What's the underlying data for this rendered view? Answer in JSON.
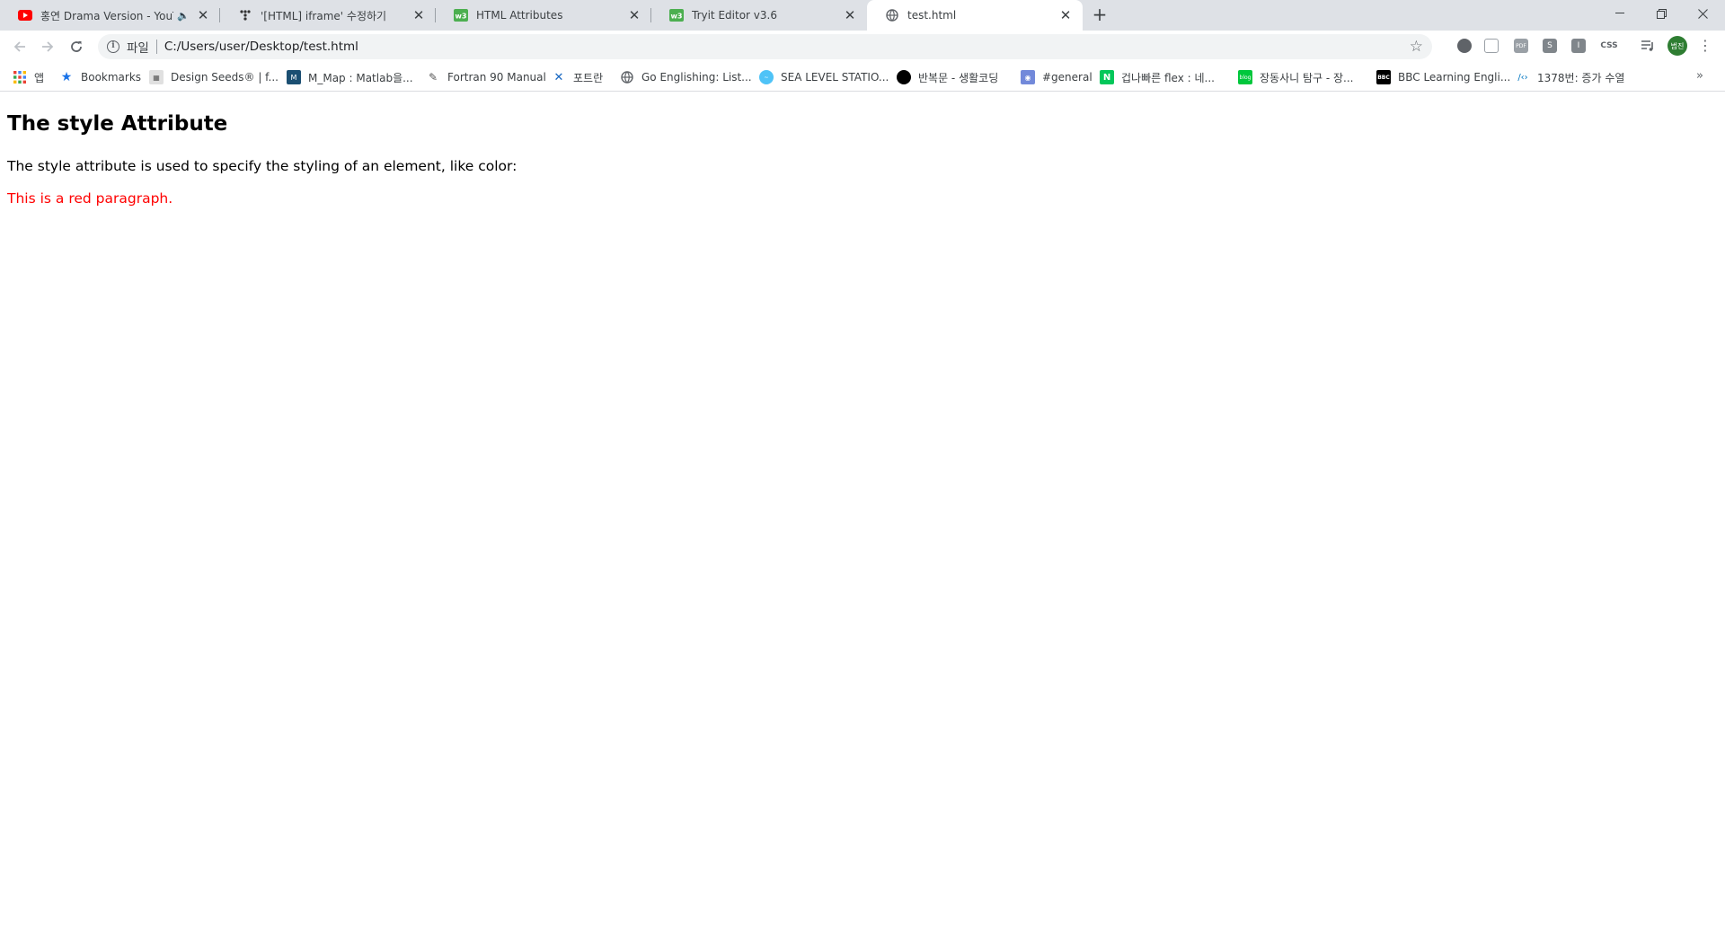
{
  "tabs": [
    {
      "title": "홍연 Drama Version - YouTube",
      "favicon": "youtube-icon",
      "muted": true
    },
    {
      "title": "'[HTML] iframe' 수정하기",
      "favicon": "tistory-icon"
    },
    {
      "title": "HTML Attributes",
      "favicon": "w3schools-icon"
    },
    {
      "title": "Tryit Editor v3.6",
      "favicon": "w3schools-icon"
    },
    {
      "title": "test.html",
      "favicon": "globe-icon",
      "active": true
    }
  ],
  "address_bar": {
    "scheme_label": "파일",
    "url": "C:/Users/user/Desktop/test.html"
  },
  "extensions": [
    {
      "label": "",
      "color": "#5f6368"
    },
    {
      "label": "",
      "color": "#9aa0a6"
    },
    {
      "label": "PDF",
      "color": "#9aa0a6"
    },
    {
      "label": "S",
      "color": "#80868b"
    },
    {
      "label": "I",
      "color": "#80868b"
    },
    {
      "label": "CSS",
      "color": "#ffffff"
    }
  ],
  "profile_initials": "범진",
  "bookmarks": [
    {
      "label": "앱",
      "icon": "apps-grid-icon",
      "color": "#ea4335"
    },
    {
      "label": "Bookmarks",
      "icon": "star-icon",
      "color": "#1a73e8"
    },
    {
      "label": "Design Seeds® | f...",
      "icon": "design-seeds-icon",
      "color": "#777777"
    },
    {
      "label": "M_Map : Matlab을...",
      "icon": "mmap-icon",
      "color": "#1b4f72"
    },
    {
      "label": "Fortran 90 Manual",
      "icon": "pencil-icon",
      "color": "#555555"
    },
    {
      "label": "포트란",
      "icon": "fortran-icon",
      "color": "#1565c0"
    },
    {
      "label": "Go Englishing: List...",
      "icon": "globe-icon",
      "color": "#5f6368"
    },
    {
      "label": "SEA LEVEL STATIO...",
      "icon": "sea-level-icon",
      "color": "#4fc3f7"
    },
    {
      "label": "반복문 - 생활코딩",
      "icon": "circle-icon",
      "color": "#000000"
    },
    {
      "label": "#general",
      "icon": "discord-icon",
      "color": "#7289da"
    },
    {
      "label": "겁나빠른 flex : 네...",
      "icon": "naver-icon",
      "color": "#03c75a"
    },
    {
      "label": "장동사니 탐구 - 장...",
      "icon": "blog-icon",
      "color": "#00c73c"
    },
    {
      "label": "BBC Learning Engli...",
      "icon": "bbc-icon",
      "color": "#000000"
    },
    {
      "label": "1378번: 증가 수열",
      "icon": "code-icon",
      "color": "#0076c0"
    }
  ],
  "page": {
    "heading": "The style Attribute",
    "paragraph": "The style attribute is used to specify the styling of an element, like color:",
    "red_paragraph": "This is a red paragraph.",
    "red_color": "#ff0000"
  }
}
